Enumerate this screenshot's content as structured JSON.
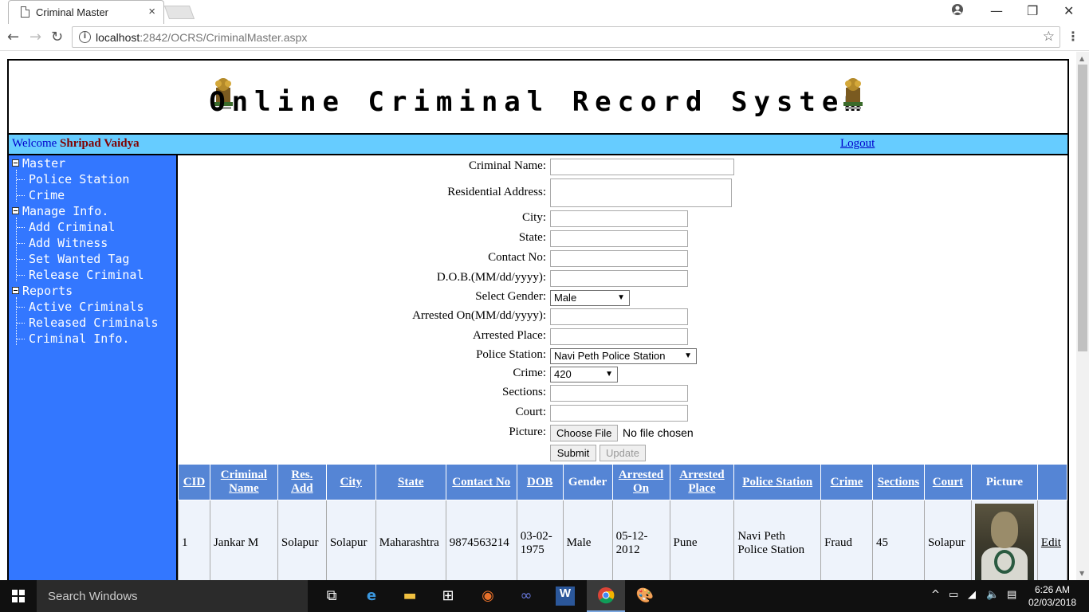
{
  "browser": {
    "tab_title": "Criminal Master",
    "tab_close": "×",
    "url_host": "localhost",
    "url_path": ":2842/OCRS/CriminalMaster.aspx",
    "window_minimize": "—",
    "window_restore": "❐",
    "window_close": "✕"
  },
  "header": {
    "title": "Online Criminal Record System"
  },
  "welcome_bar": {
    "welcome_text": "Welcome ",
    "user_name": "Shripad Vaidya",
    "logout": "Logout"
  },
  "sidebar": {
    "groups": [
      {
        "label": "Master",
        "items": [
          "Police Station",
          "Crime"
        ]
      },
      {
        "label": "Manage Info.",
        "items": [
          "Add Criminal",
          "Add Witness",
          "Set Wanted Tag",
          "Release Criminal"
        ]
      },
      {
        "label": "Reports",
        "items": [
          "Active Criminals",
          "Released Criminals",
          "Criminal Info."
        ]
      }
    ]
  },
  "form": {
    "criminal_name_label": "Criminal Name:",
    "residential_address_label": "Residential Address:",
    "city_label": "City:",
    "state_label": "State:",
    "contact_label": "Contact No:",
    "dob_label": "D.O.B.(MM/dd/yyyy):",
    "gender_label": "Select Gender:",
    "gender_value": "Male",
    "arrested_on_label": "Arrested On(MM/dd/yyyy):",
    "arrested_place_label": "Arrested Place:",
    "police_station_label": "Police Station:",
    "police_station_value": "Navi Peth Police Station",
    "crime_label": "Crime:",
    "crime_value": "420",
    "sections_label": "Sections:",
    "court_label": "Court:",
    "picture_label": "Picture:",
    "choose_file": "Choose File",
    "no_file": "No file chosen",
    "submit": "Submit",
    "update": "Update"
  },
  "grid": {
    "headers": [
      "CID",
      "Criminal Name",
      "Res. Add",
      "City",
      "State",
      "Contact No",
      "DOB",
      "Gender",
      "Arrested On",
      "Arrested Place",
      "Police Station",
      "Crime",
      "Sections",
      "Court",
      "Picture",
      ""
    ],
    "rows": [
      {
        "cid": "1",
        "name": "Jankar M",
        "res_add": "Solapur",
        "city": "Solapur",
        "state": "Maharashtra",
        "contact": "9874563214",
        "dob": "03-02-1975",
        "gender": "Male",
        "arrested_on": "05-12-2012",
        "arrested_place": "Pune",
        "police_station": "Navi Peth Police Station",
        "crime": "Fraud",
        "sections": "45",
        "court": "Solapur",
        "edit": "Edit"
      }
    ]
  },
  "taskbar": {
    "search_placeholder": "Search Windows",
    "time": "6:26 AM",
    "date": "02/03/2018"
  }
}
